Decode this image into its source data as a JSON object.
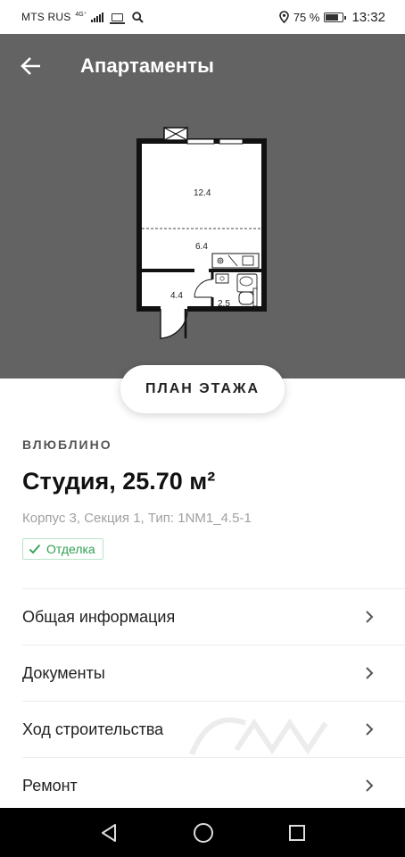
{
  "status_bar": {
    "carrier": "MTS RUS",
    "network": "4G⁺",
    "battery_percent": "75 %",
    "battery_level": 0.75,
    "time": "13:32",
    "icons": [
      "signal-icon",
      "laptop-icon",
      "search-icon",
      "location-icon",
      "battery-icon"
    ]
  },
  "header": {
    "title": "Апартаменты",
    "back_icon": "arrow-left-icon"
  },
  "floor_plan": {
    "rooms": [
      {
        "name": "main-room",
        "area": "12.4"
      },
      {
        "name": "kitchen",
        "area": "6.4"
      },
      {
        "name": "hall",
        "area": "4.4"
      },
      {
        "name": "bathroom",
        "area": "2.5"
      }
    ],
    "background": "#636363"
  },
  "floor_button": {
    "label": "ПЛАН ЭТАЖА"
  },
  "listing": {
    "district": "ВЛЮБЛИНО",
    "title": "Студия, 25.70 м²",
    "subtitle": "Корпус 3, Секция 1, Тип: 1NM1_4.5-1",
    "badge": {
      "icon": "check-icon",
      "label": "Отделка",
      "color": "#2ea050"
    }
  },
  "menu": {
    "items": [
      {
        "label": "Общая информация"
      },
      {
        "label": "Документы"
      },
      {
        "label": "Ход строительства"
      },
      {
        "label": "Ремонт"
      }
    ],
    "chevron_icon": "chevron-right-icon"
  },
  "system_nav": {
    "buttons": [
      "back-triangle-icon",
      "home-circle-icon",
      "recents-square-icon"
    ]
  }
}
